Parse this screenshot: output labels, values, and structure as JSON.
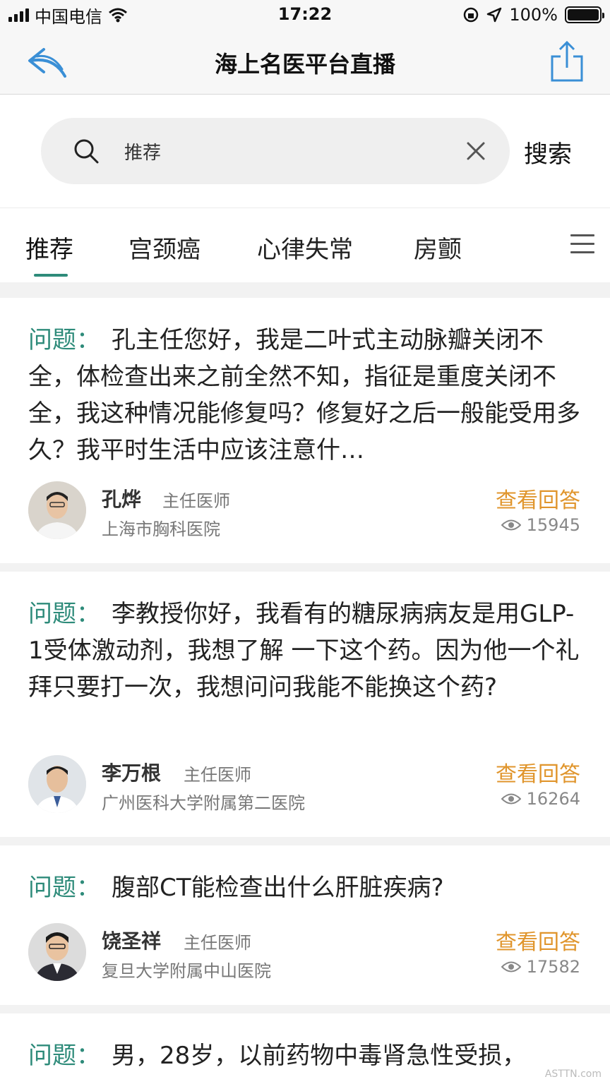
{
  "status_bar": {
    "carrier": "中国电信",
    "time": "17:22",
    "battery": "100%"
  },
  "nav": {
    "title": "海上名医平台直播",
    "back_icon": "back-arrow-icon",
    "share_icon": "share-icon"
  },
  "search": {
    "value": "推荐",
    "button": "搜索"
  },
  "tabs": [
    "推荐",
    "宫颈癌",
    "心律失常",
    "房颤"
  ],
  "question_label": "问题：",
  "view_label": "查看回答",
  "cards": [
    {
      "question": "孔主任您好，我是二叶式主动脉瓣关闭不全，体检查出来之前全然不知，指征是重度关闭不全，我这种情况能修复吗？修复好之后一般能受用多久？我平时生活中应该注意什…",
      "doctor": "孔烨",
      "title": "主任医师",
      "hospital": "上海市胸科医院",
      "views": "15945"
    },
    {
      "question": "李教授你好，我看有的糖尿病病友是用GLP-1受体激动剂，我想了解 一下这个药。因为他一个礼拜只要打一次，我想问问我能不能换这个药?",
      "doctor": "李万根",
      "title": "主任医师",
      "hospital": "广州医科大学附属第二医院",
      "views": "16264"
    },
    {
      "question": "腹部CT能检查出什么肝脏疾病?",
      "doctor": "饶圣祥",
      "title": "主任医师",
      "hospital": "复旦大学附属中山医院",
      "views": "17582"
    },
    {
      "question": "男，28岁，以前药物中毒肾急性受损，"
    }
  ],
  "watermark": "ASTTN.com"
}
